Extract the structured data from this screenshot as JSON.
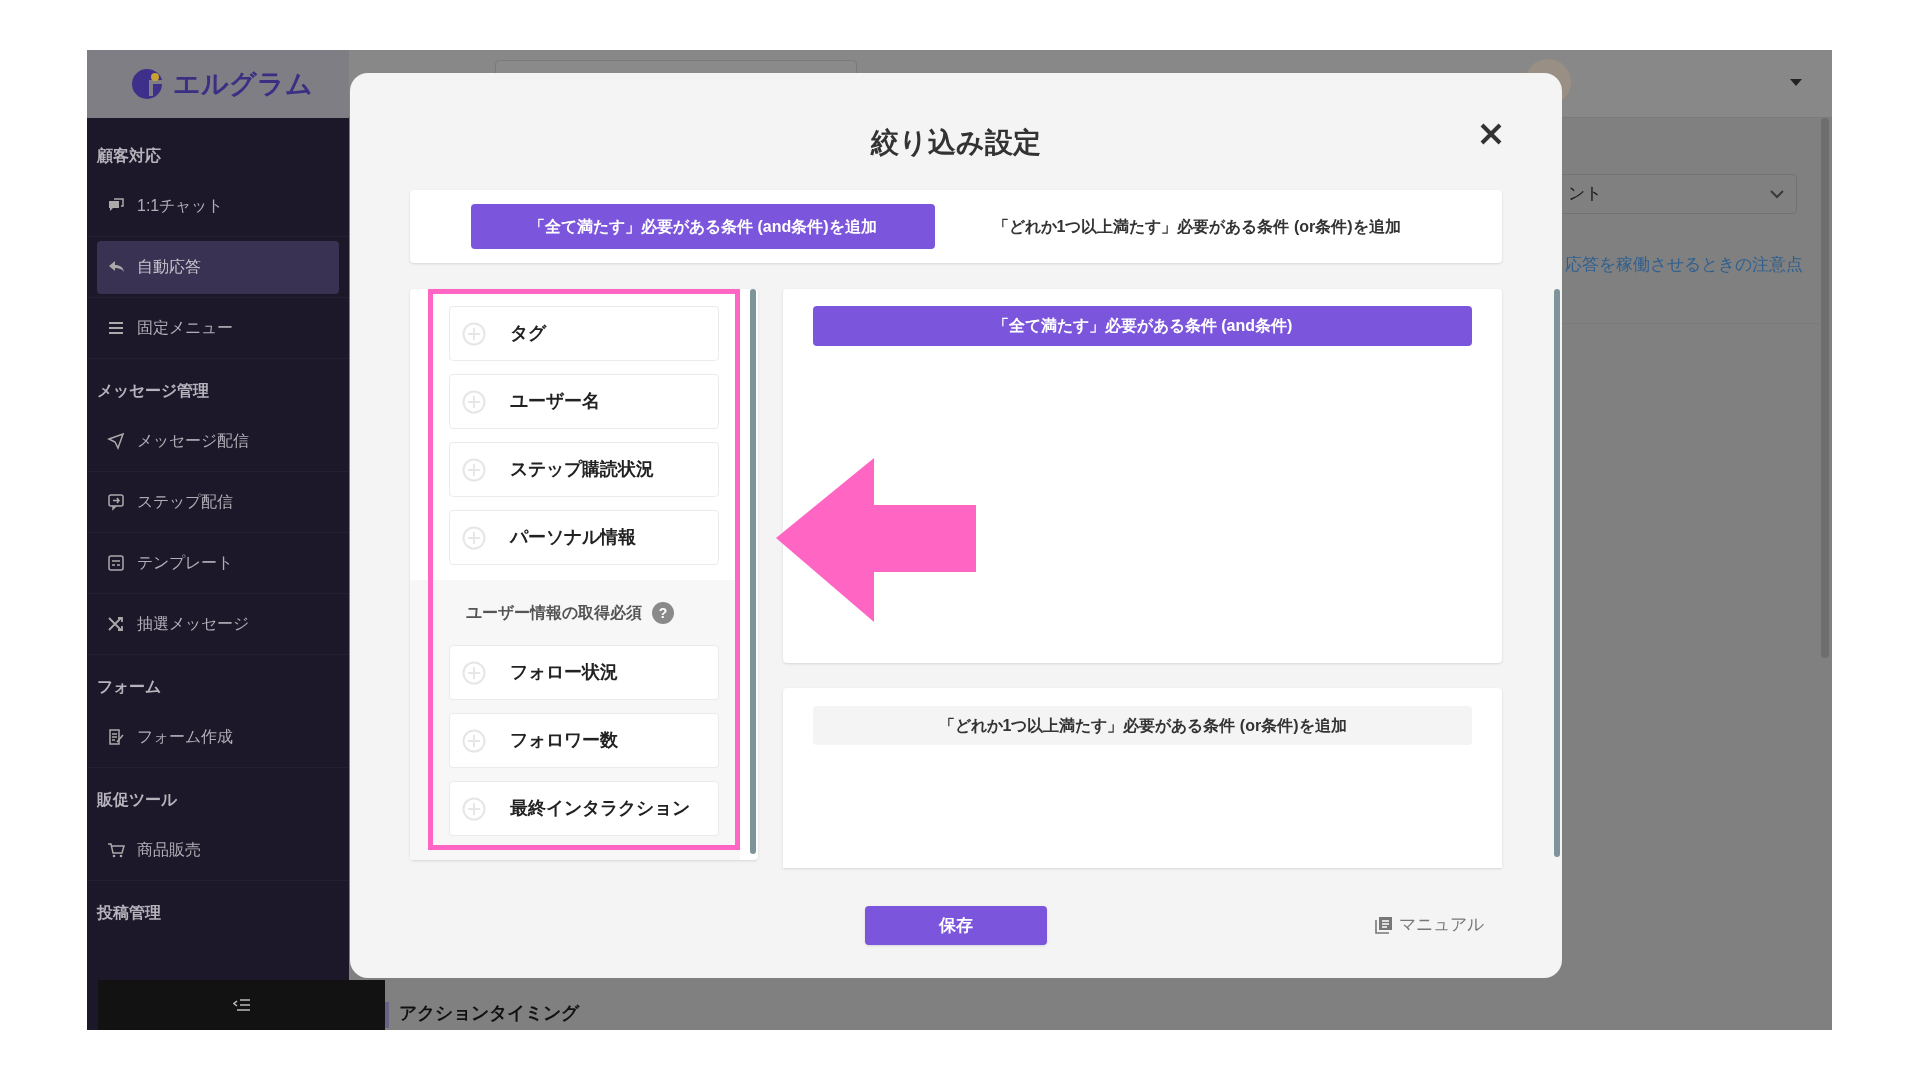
{
  "header": {
    "logo": "エルグラム"
  },
  "sidebar": {
    "sections": [
      {
        "heading": "顧客対応",
        "items": [
          {
            "label": "1:1チャット",
            "selected": false
          },
          {
            "label": "自動応答",
            "selected": true
          },
          {
            "label": "固定メニュー",
            "selected": false
          }
        ]
      },
      {
        "heading": "メッセージ管理",
        "items": [
          {
            "label": "メッセージ配信",
            "selected": false
          },
          {
            "label": "ステップ配信",
            "selected": false
          },
          {
            "label": "テンプレート",
            "selected": false
          },
          {
            "label": "抽選メッセージ",
            "selected": false
          }
        ]
      },
      {
        "heading": "フォーム",
        "items": [
          {
            "label": "フォーム作成",
            "selected": false
          }
        ]
      },
      {
        "heading": "販促ツール",
        "items": [
          {
            "label": "商品販売",
            "selected": false
          }
        ]
      },
      {
        "heading": "投稿管理"
      }
    ]
  },
  "background": {
    "dropdown_value": "ント",
    "link": "応答を稼働させるときの注意点",
    "section_heading": "アクションタイミング"
  },
  "modal": {
    "title": "絞り込み設定",
    "tabs": [
      {
        "label": "「全て満たす」必要がある条件 (and条件)を追加",
        "selected": true
      },
      {
        "label": "「どれか1つ以上満たす」必要がある条件 (or条件)を追加",
        "selected": false
      }
    ],
    "conditions": [
      {
        "label": "タグ"
      },
      {
        "label": "ユーザー名"
      },
      {
        "label": "ステップ購読状況"
      },
      {
        "label": "パーソナル情報"
      }
    ],
    "restricted_group": {
      "label": "ユーザー情報の取得必須",
      "help": "?",
      "conditions": [
        {
          "label": "フォロー状況"
        },
        {
          "label": "フォロワー数"
        },
        {
          "label": "最終インタラクション"
        }
      ]
    },
    "and_panel": {
      "header": "「全て満たす」必要がある条件 (and条件)"
    },
    "or_panel": {
      "header": "「どれか1つ以上満たす」必要がある条件 (or条件)を追加"
    },
    "save_button": "保存",
    "manual_link": "マニュアル"
  }
}
